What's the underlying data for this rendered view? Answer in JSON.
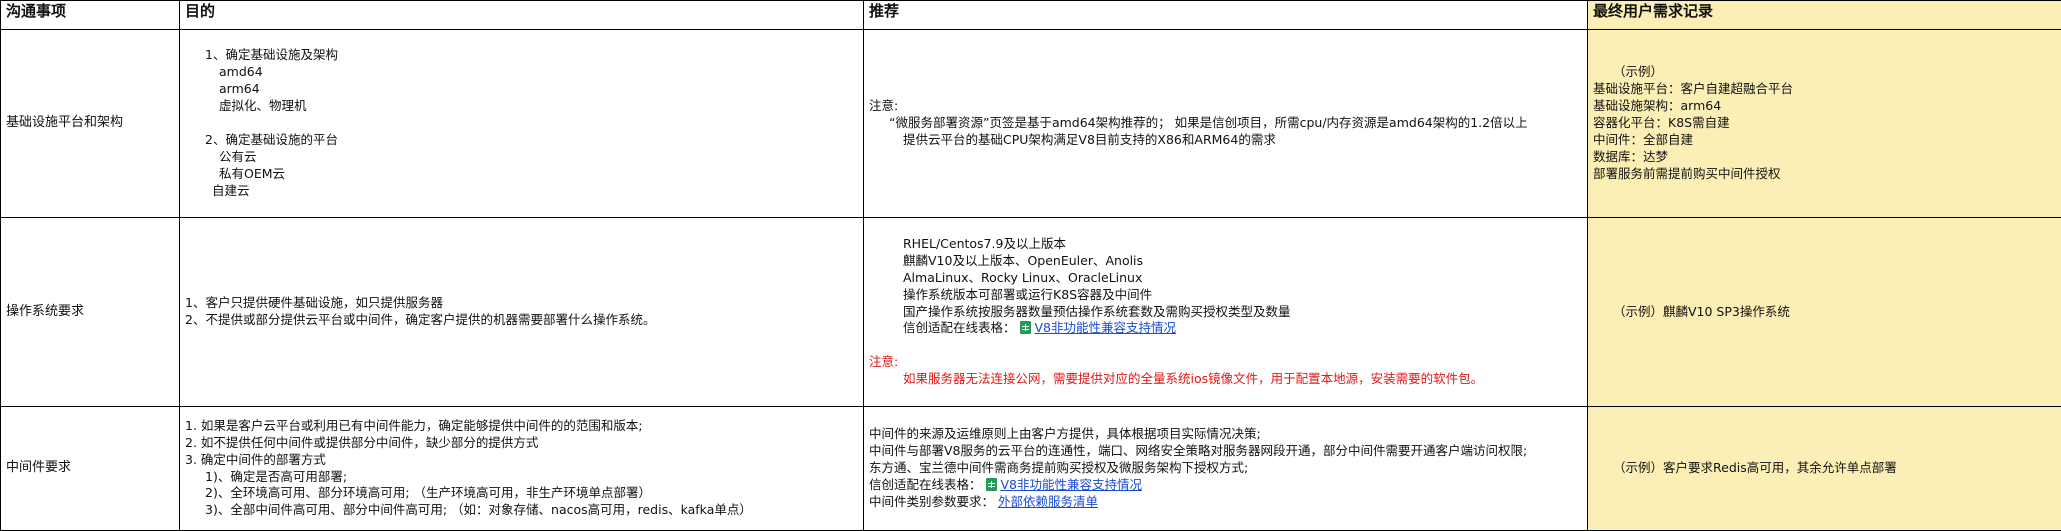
{
  "headers": {
    "c1": "沟通事项",
    "c2": "目的",
    "c3": "推荐",
    "c4": "最终用户需求记录"
  },
  "row1": {
    "label": "基础设施平台和架构",
    "purpose": [
      "1、确定基础设施及架构",
      "amd64",
      "arm64",
      "虚拟化、物理机",
      "2、确定基础设施的平台",
      "公有云",
      "私有OEM云",
      "自建云"
    ],
    "rec_note": "注意:",
    "rec_lines": [
      "“微服务部署资源”页签是基于amd64架构推荐的；  如果是信创项目，所需cpu/内存资源是amd64架构的1.2倍以上",
      "提供云平台的基础CPU架构满足V8目前支持的X86和ARM64的需求"
    ],
    "record": [
      "（示例）",
      "基础设施平台：客户自建超融合平台",
      "基础设施架构：arm64",
      "容器化平台：K8S需自建",
      "中间件：全部自建",
      "数据库：达梦",
      "部署服务前需提前购买中间件授权"
    ]
  },
  "row2": {
    "label": "操作系统要求",
    "purpose": [
      "1、客户只提供硬件基础设施，如只提供服务器",
      "2、不提供或部分提供云平台或中间件，确定客户提供的机器需要部署什么操作系统。"
    ],
    "rec_lines": [
      "RHEL/Centos7.9及以上版本",
      "麒麟V10及以上版本、OpenEuler、Anolis",
      "AlmaLinux、Rocky Linux、OracleLinux",
      "操作系统版本可部署或运行K8S容器及中间件",
      "国产操作系统按服务器数量预估操作系统套数及需购买授权类型及数量"
    ],
    "sheet_label": "信创适配在线表格：",
    "sheet_link": "V8非功能性兼容支持情况",
    "warn_title": "注意:",
    "warn_text": "如果服务器无法连接公网，需要提供对应的全量系统ios镜像文件，用于配置本地源，安装需要的软件包。",
    "record": "（示例）麒麟V10 SP3操作系统"
  },
  "row3": {
    "label": "中间件要求",
    "purpose": [
      "1. 如果是客户云平台或利用已有中间件能力，确定能够提供中间件的的范围和版本;",
      "2. 如不提供任何中间件或提供部分中间件，缺少部分的提供方式",
      "3. 确定中间件的部署方式",
      "1)、确定是否高可用部署;",
      "2)、全环境高可用、部分环境高可用;  （生产环境高可用，非生产环境单点部署）",
      "3)、全部中间件高可用、部分中间件高可用;  （如：对象存储、nacos高可用，redis、kafka单点）"
    ],
    "rec_lines": [
      "中间件的来源及运维原则上由客户方提供，具体根据项目实际情况决策;",
      "中间件与部署V8服务的云平台的连通性，端口、网络安全策略对服务器网段开通，部分中间件需要开通客户端访问权限;",
      "东方通、宝兰德中间件需商务提前购买授权及微服务架构下授权方式;"
    ],
    "sheet_label": "信创适配在线表格：",
    "sheet_link": "V8非功能性兼容支持情况",
    "deps_label": "中间件类别参数要求：",
    "deps_link": "外部依赖服务清单",
    "record": "（示例）客户要求Redis高可用，其余允许单点部署"
  }
}
